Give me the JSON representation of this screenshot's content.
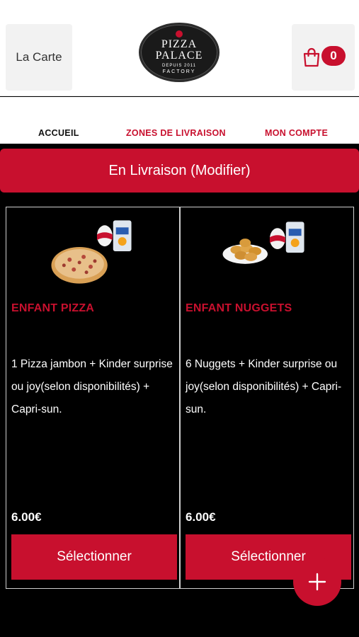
{
  "header": {
    "menu_label": "La Carte",
    "logo": {
      "line1": "PIZZA",
      "line2": "PALACE",
      "line3": "DEPUIS 2011",
      "line4": "FACTORY"
    },
    "cart_count": "0"
  },
  "nav": {
    "items": [
      {
        "label": "ACCUEIL"
      },
      {
        "label": "ZONES DE LIVRAISON"
      },
      {
        "label": "MON COMPTE"
      }
    ]
  },
  "delivery": {
    "label": "En Livraison (Modifier)"
  },
  "products": [
    {
      "title": "ENFANT PIZZA",
      "description": "1 Pizza jambon + Kinder surprise ou joy(selon disponibilités) + Capri-sun.",
      "price": "6.00€",
      "button": "Sélectionner"
    },
    {
      "title": "ENFANT NUGGETS",
      "description": "6 Nuggets + Kinder surprise ou joy(selon disponibilités) + Capri-sun.",
      "price": "6.00€",
      "button": "Sélectionner"
    }
  ],
  "colors": {
    "accent": "#c8102e",
    "background": "#000000",
    "header": "#ffffff"
  },
  "icons": {
    "cart": "shopping-bag-icon",
    "fab": "plus-icon"
  }
}
